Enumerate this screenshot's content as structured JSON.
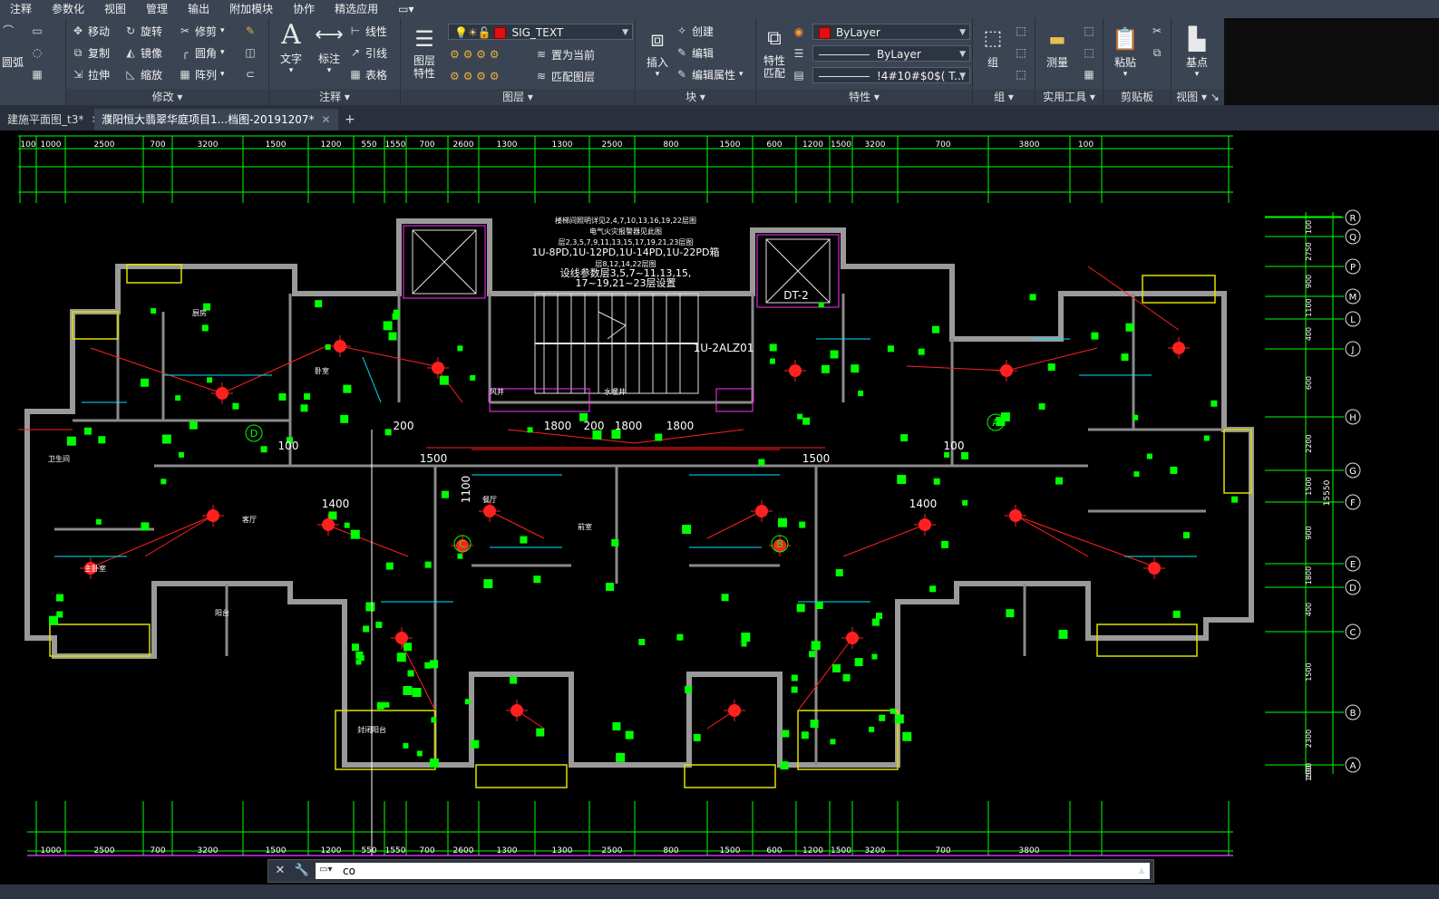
{
  "menubar": {
    "items": [
      "注释",
      "参数化",
      "视图",
      "管理",
      "输出",
      "附加模块",
      "协作",
      "精选应用"
    ]
  },
  "ribbon": {
    "draw": {
      "arc": "圆弧"
    },
    "modify": {
      "title": "修改",
      "move": "移动",
      "rotate": "旋转",
      "trim": "修剪",
      "copy": "复制",
      "mirror": "镜像",
      "fillet": "圆角",
      "stretch": "拉伸",
      "scale": "缩放",
      "array": "阵列"
    },
    "annotation": {
      "title": "注释",
      "text": "文字",
      "dimension": "标注",
      "linear": "线性",
      "leader": "引线",
      "table": "表格"
    },
    "layers": {
      "title": "图层",
      "layer_props": "图层\n特性",
      "current_layer": "SIG_TEXT",
      "make_current": "置为当前",
      "match_layer": "匹配图层"
    },
    "block": {
      "title": "块",
      "insert": "插入",
      "create": "创建",
      "edit": "编辑",
      "edit_attr": "编辑属性"
    },
    "properties": {
      "title": "特性",
      "match": "特性\n匹配",
      "color": "ByLayer",
      "linetype": "ByLayer",
      "lineweight": "!4#10#$0$( T..."
    },
    "groups": {
      "title": "组",
      "group": "组"
    },
    "utilities": {
      "title": "实用工具",
      "measure": "测量"
    },
    "clipboard": {
      "title": "剪贴板",
      "paste": "粘贴"
    },
    "view": {
      "title": "视图",
      "base": "基点"
    }
  },
  "tabs": [
    {
      "label": "建施平面图_t3*"
    },
    {
      "label": "濮阳恒大翡翠华庭项目1...档图-20191207*"
    }
  ],
  "drawing": {
    "dim_top": [
      "100",
      "1000",
      "2500",
      "700",
      "3200",
      "1500",
      "1200",
      "550",
      "1550",
      "700",
      "2600",
      "1300",
      "1300",
      "2500",
      "800",
      "1500",
      "600",
      "1200",
      "1500",
      "3200",
      "700",
      "3800",
      "100"
    ],
    "dim_bottom": [
      "1000",
      "2500",
      "700",
      "3200",
      "1500",
      "1200",
      "550",
      "1550",
      "700",
      "2600",
      "1300",
      "1300",
      "2500",
      "800",
      "1500",
      "600",
      "1200",
      "1500",
      "3200",
      "700",
      "3800"
    ],
    "grid_axes": [
      "R",
      "Q",
      "P",
      "M",
      "L",
      "J",
      "H",
      "G",
      "F",
      "E",
      "D",
      "C",
      "B",
      "A"
    ],
    "grid_dims": [
      "100",
      "2750",
      "900",
      "1100",
      "400",
      "600",
      "2200",
      "1500",
      "900",
      "1800",
      "400",
      "1500",
      "2300",
      "1500",
      "100"
    ],
    "total_dim": "15550",
    "unit_labels": [
      "D",
      "A",
      "C",
      "B"
    ],
    "notes": [
      "楼梯间照明详见2,4,7,10,13,16,19,22层图",
      "电气火灾报警器见此图",
      "层2,3,5,7,9,11,13,15,17,19,21,23层图",
      "1U-8PD,1U-12PD,1U-14PD,1U-22PD箱",
      "层8,12,14,22层图",
      "设线参数层3,5,7~11,13,15,",
      "17~19,21~23层设置"
    ],
    "tags": [
      "DT-2",
      "1U-2ALZ01",
      "1800",
      "1800",
      "1800",
      "1100",
      "1400",
      "1400",
      "1500",
      "1500",
      "200",
      "200",
      "100",
      "100"
    ],
    "room_labels": [
      "厨房",
      "客厅",
      "卧室",
      "主卧室",
      "卫生间",
      "阳台",
      "封闭阳台",
      "餐厅",
      "风井",
      "水暖井",
      "前室"
    ]
  },
  "command": {
    "value": "co"
  },
  "colors": {
    "ribbon_bg": "#3b4453",
    "canvas_bg": "#000000",
    "wall": "#9a9a9a",
    "dim_green": "#00ff00",
    "cyan": "#00e5ff",
    "red": "#ff2020",
    "yellow": "#ffff00"
  }
}
